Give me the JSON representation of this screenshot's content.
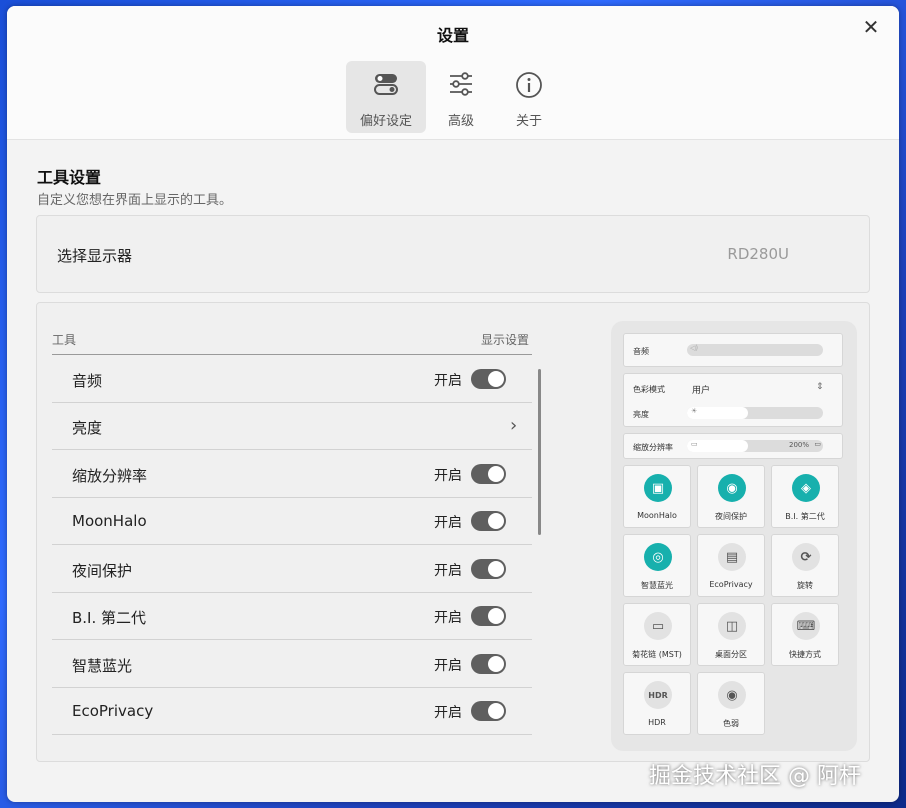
{
  "window": {
    "title": "设置"
  },
  "tabs": [
    {
      "label": "偏好设定",
      "icon": "toggle-icon"
    },
    {
      "label": "高级",
      "icon": "sliders-icon"
    },
    {
      "label": "关于",
      "icon": "info-icon"
    }
  ],
  "section": {
    "title": "工具设置",
    "description": "自定义您想在界面上显示的工具。"
  },
  "monitor": {
    "label": "选择显示器",
    "value": "RD280U"
  },
  "tools_table": {
    "col_tool": "工具",
    "col_display": "显示设置",
    "rows": [
      {
        "name": "音频",
        "state": "开启"
      },
      {
        "name": "亮度",
        "state": ""
      },
      {
        "name": "缩放分辨率",
        "state": "开启"
      },
      {
        "name": "MoonHalo",
        "state": "开启"
      },
      {
        "name": "夜间保护",
        "state": "开启"
      },
      {
        "name": "B.I. 第二代",
        "state": "开启"
      },
      {
        "name": "智慧蓝光",
        "state": "开启"
      },
      {
        "name": "EcoPrivacy",
        "state": "开启"
      }
    ]
  },
  "preview": {
    "audio_label": "音频",
    "color_mode_label": "色彩模式",
    "color_mode_value": "用户",
    "brightness_label": "亮度",
    "brightness_level": 0.45,
    "scale_label": "缩放分辨率",
    "scale_value": "200%",
    "scale_level": 0.45,
    "tiles": [
      {
        "label": "MoonHalo",
        "icon": "moonhalo-icon",
        "active": true
      },
      {
        "label": "夜间保护",
        "icon": "night-protect-icon",
        "active": true
      },
      {
        "label": "B.I. 第二代",
        "icon": "bi-gen2-icon",
        "active": true
      },
      {
        "label": "智慧蓝光",
        "icon": "smart-bluelight-icon",
        "active": true
      },
      {
        "label": "EcoPrivacy",
        "icon": "ecoprivacy-icon",
        "active": false
      },
      {
        "label": "旋转",
        "icon": "rotate-icon",
        "active": false
      },
      {
        "label": "菊花链 (MST)",
        "icon": "daisy-chain-icon",
        "active": false
      },
      {
        "label": "桌面分区",
        "icon": "desktop-partition-icon",
        "active": false
      },
      {
        "label": "快捷方式",
        "icon": "shortcut-icon",
        "active": false
      },
      {
        "label": "HDR",
        "icon": "hdr-icon",
        "active": false
      },
      {
        "label": "色弱",
        "icon": "eye-icon",
        "active": false
      }
    ]
  },
  "watermark": "掘金技术社区 @ 阿杆",
  "colors": {
    "accent": "#17b0ad",
    "toggle_on": "#5f5f5f"
  }
}
